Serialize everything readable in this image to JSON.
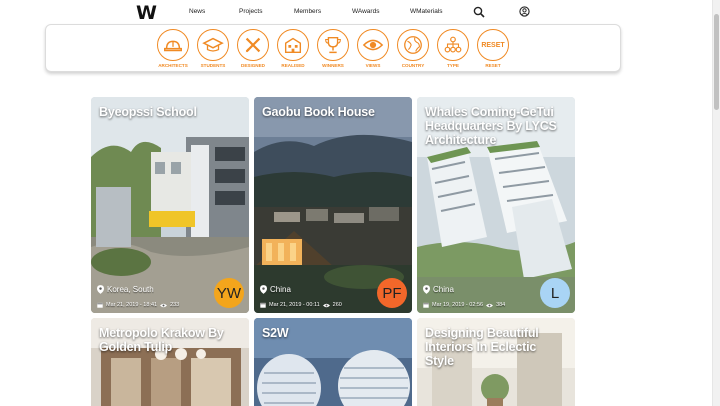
{
  "nav": {
    "logo": "W",
    "links": [
      "News",
      "Projects",
      "Members",
      "WAwards",
      "WMaterials"
    ]
  },
  "filters": [
    {
      "label": "Architects",
      "icon": "hard-hat-icon"
    },
    {
      "label": "Students",
      "icon": "graduation-cap-icon"
    },
    {
      "label": "Designed",
      "icon": "pencil-ruler-icon"
    },
    {
      "label": "Realised",
      "icon": "building-icon"
    },
    {
      "label": "Winners",
      "icon": "trophy-icon"
    },
    {
      "label": "Views",
      "icon": "eye-icon"
    },
    {
      "label": "Country",
      "icon": "globe-icon"
    },
    {
      "label": "Type",
      "icon": "hierarchy-icon"
    },
    {
      "label": "Reset",
      "icon_text": "RESET"
    }
  ],
  "cards": [
    {
      "title": "Byeopssi School",
      "country": "Korea, South",
      "date": "Mar 21, 2019 - 18:41",
      "views": "233",
      "avatar": "YW",
      "avatar_color": "#f3a51c"
    },
    {
      "title": "Gaobu Book House",
      "country": "China",
      "date": "Mar 21, 2019 - 00:11",
      "views": "260",
      "avatar": "PF",
      "avatar_color": "#f2672a"
    },
    {
      "title": "Whales Coming-GeTui Headquarters By LYCS Architecture",
      "country": "China",
      "date": "Mar 19, 2019 - 02:56",
      "views": "384",
      "avatar": "L",
      "avatar_color": "#a9d4f5"
    },
    {
      "title": "Metropolo Krakow By Golden Tulip",
      "country": "",
      "date": "",
      "views": "",
      "avatar": "",
      "avatar_color": ""
    },
    {
      "title": "S2W",
      "country": "",
      "date": "",
      "views": "",
      "avatar": "",
      "avatar_color": ""
    },
    {
      "title": "Designing Beautiful Interiors In Eclectic Style",
      "country": "",
      "date": "",
      "views": "",
      "avatar": "",
      "avatar_color": ""
    }
  ]
}
